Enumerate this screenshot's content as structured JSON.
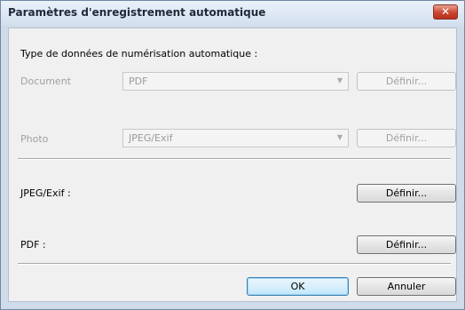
{
  "dialog": {
    "title": "Paramètres d'enregistrement automatique",
    "close_label": "✕"
  },
  "section": {
    "heading": "Type de données de numérisation automatique :"
  },
  "document": {
    "label": "Document",
    "selected": "PDF",
    "button": "Définir..."
  },
  "photo": {
    "label": "Photo",
    "selected": "JPEG/Exif",
    "button": "Définir..."
  },
  "jpeg": {
    "label": "JPEG/Exif :",
    "button": "Définir..."
  },
  "pdf": {
    "label": "PDF :",
    "button": "Définir..."
  },
  "footer": {
    "ok": "OK",
    "cancel": "Annuler"
  },
  "icons": {
    "dropdown": "chevron-down-icon",
    "close": "close-icon"
  }
}
